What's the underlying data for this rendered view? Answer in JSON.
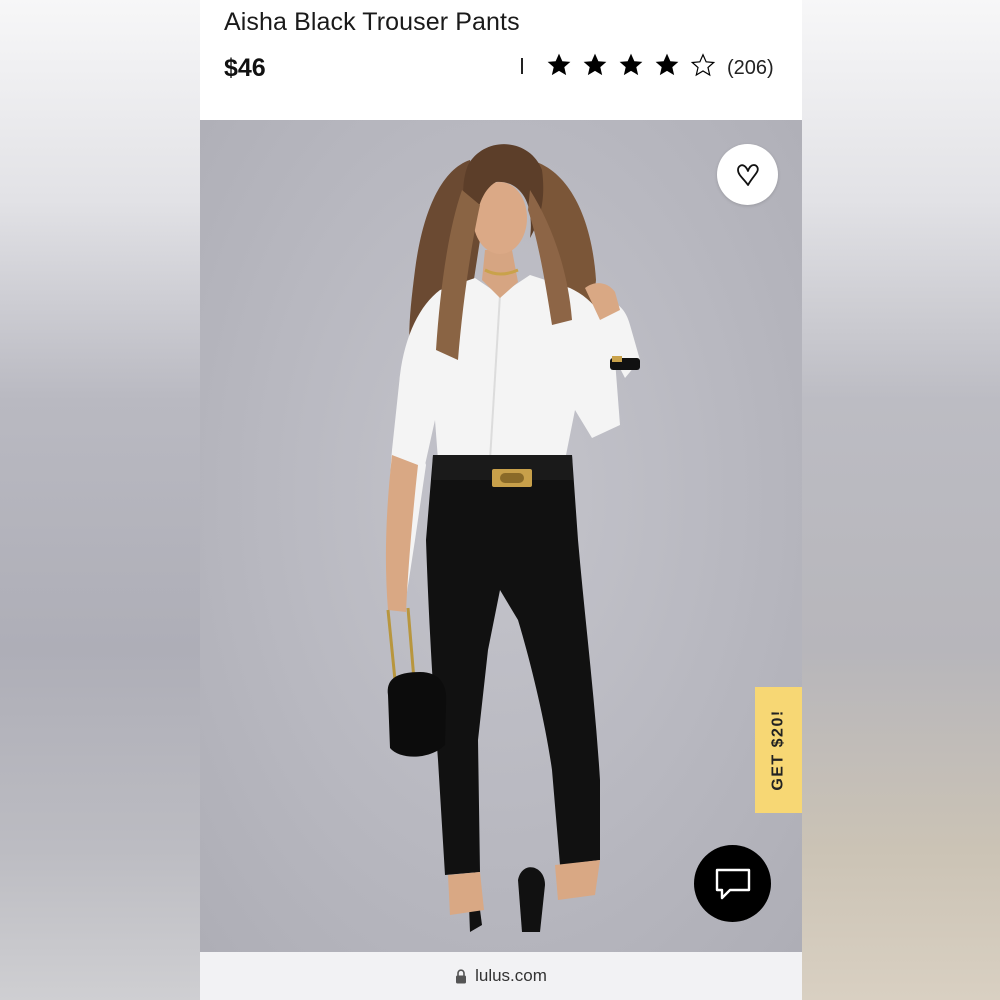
{
  "product": {
    "title": "Aisha Black Trouser Pants",
    "price": "$46",
    "rating": {
      "stars_filled": 4,
      "stars_total": 5,
      "count_label": "(206)"
    }
  },
  "photo": {
    "alt": "Model wearing black trouser pants with white blouse",
    "background_color": "#b9b9c1"
  },
  "actions": {
    "favorite_icon": "heart-icon",
    "promo_label": "GET $20!",
    "promo_color": "#f7d774",
    "chat_icon": "chat-bubble-icon"
  },
  "browser": {
    "lock_icon": "lock-icon",
    "url": "lulus.com"
  }
}
